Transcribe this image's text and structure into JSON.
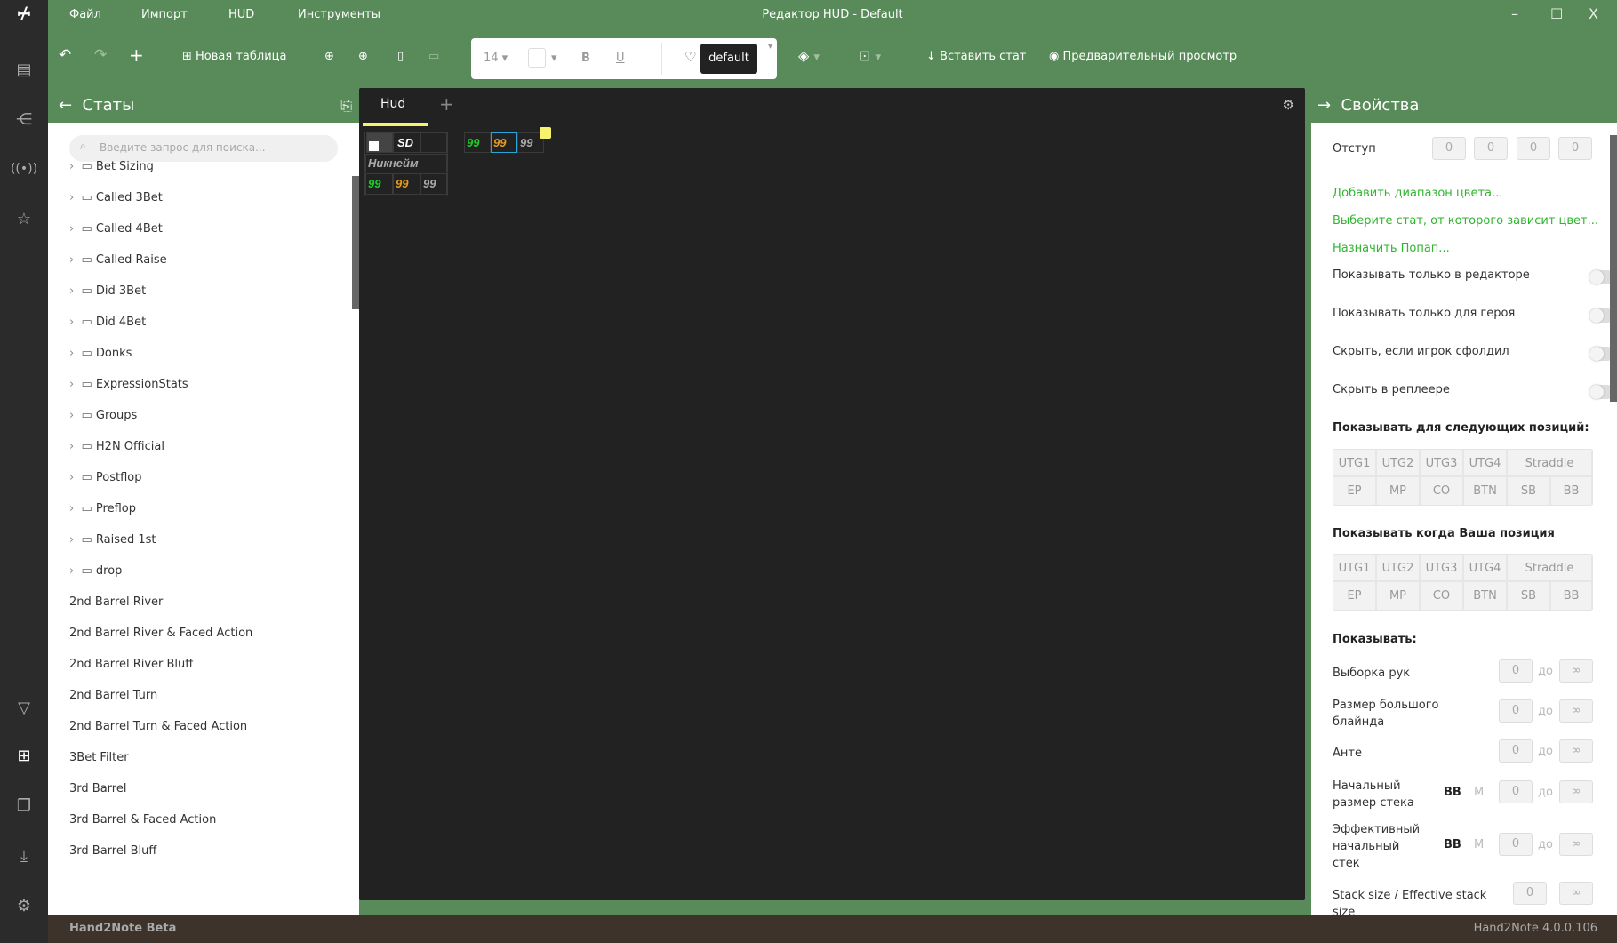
{
  "window": {
    "title": "Редактор HUD - Default",
    "minimize": "–",
    "maximize": "☐",
    "close": "X"
  },
  "menu": [
    "Файл",
    "Импорт",
    "HUD",
    "Инструменты"
  ],
  "rail": {
    "top": [
      "logo-icon",
      "report-icon",
      "share-icon",
      "broadcast-icon",
      "stars-icon"
    ],
    "bottom": [
      "filter-icon",
      "hud-icon",
      "windows-icon",
      "download-icon",
      "gear-icon"
    ]
  },
  "toolbar": {
    "new_table": "Новая таблица",
    "font_size": "14",
    "bold": "B",
    "underline": "U",
    "style": "default",
    "insert_stat": "Вставить стат",
    "preview": "Предварительный просмотр"
  },
  "left_panel": {
    "title": "Статы",
    "search_placeholder": "Введите запрос для поиска...",
    "folders": [
      "Bet Sizing",
      "Called 3Bet",
      "Called 4Bet",
      "Called Raise",
      "Did 3Bet",
      "Did 4Bet",
      "Donks",
      "ExpressionStats",
      "Groups",
      "H2N Official",
      "Postflop",
      "Preflop",
      "Raised 1st",
      "drop"
    ],
    "stats": [
      "2nd Barrel River",
      "2nd Barrel River & Faced Action",
      "2nd Barrel River Bluff",
      "2nd Barrel Turn",
      "2nd Barrel Turn & Faced Action",
      "3Bet Filter",
      "3rd Barrel",
      "3rd Barrel & Faced Action",
      "3rd Barrel Bluff"
    ]
  },
  "canvas": {
    "tab": "Hud",
    "add_tab": "+",
    "hud": {
      "sd": "SD",
      "nickname": "Никнейм",
      "values": [
        "99",
        "99",
        "99"
      ]
    },
    "panel2": [
      "99",
      "99",
      "99"
    ],
    "colors": {
      "green": "#1fcc2a",
      "orange": "#e59a1a",
      "gray": "#aaaaaa",
      "selected": "#2aa3d8",
      "marker": "#f7f26e"
    }
  },
  "right_panel": {
    "title": "Свойства",
    "indent_label": "Отступ",
    "indent": [
      "0",
      "0",
      "0",
      "0"
    ],
    "links": [
      "Добавить диапазон цвета...",
      "Выберите стат, от которого зависит цвет...",
      "Назначить Попап..."
    ],
    "toggles": [
      {
        "label": "Показывать только в редакторе",
        "on": false
      },
      {
        "label": "Показывать только для героя",
        "on": false
      },
      {
        "label": "Скрыть, если игрок сфолдил",
        "on": false
      },
      {
        "label": "Скрыть в реплеере",
        "on": false
      }
    ],
    "positions_heading": "Показывать для следующих позиций:",
    "hero_heading": "Показывать когда Ваша позиция",
    "pos_row1": [
      "UTG1",
      "UTG2",
      "UTG3",
      "UTG4",
      "Straddle"
    ],
    "pos_row2": [
      "EP",
      "MP",
      "CO",
      "BTN",
      "SB",
      "BB"
    ],
    "show_heading": "Показывать:",
    "to": "до",
    "inf": "∞",
    "bb": "BB",
    "m": "M",
    "ranges": [
      {
        "label": "Выборка рук",
        "from": "0"
      },
      {
        "label": "Размер большого блайнда",
        "from": "0"
      },
      {
        "label": "Анте",
        "from": "0"
      },
      {
        "label": "Начальный размер стека",
        "from": "0"
      },
      {
        "label": "Эффективный начальный стек",
        "from": "0"
      },
      {
        "label": "Stack size / Effective stack size",
        "from": "0"
      }
    ],
    "accent": "#2fb52f"
  },
  "status": {
    "left": "Hand2Note Beta",
    "right": "Hand2Note 4.0.0.106"
  },
  "theme": {
    "green": "#588b59",
    "dark": "#2b2b2b",
    "status": "#3d332b"
  }
}
